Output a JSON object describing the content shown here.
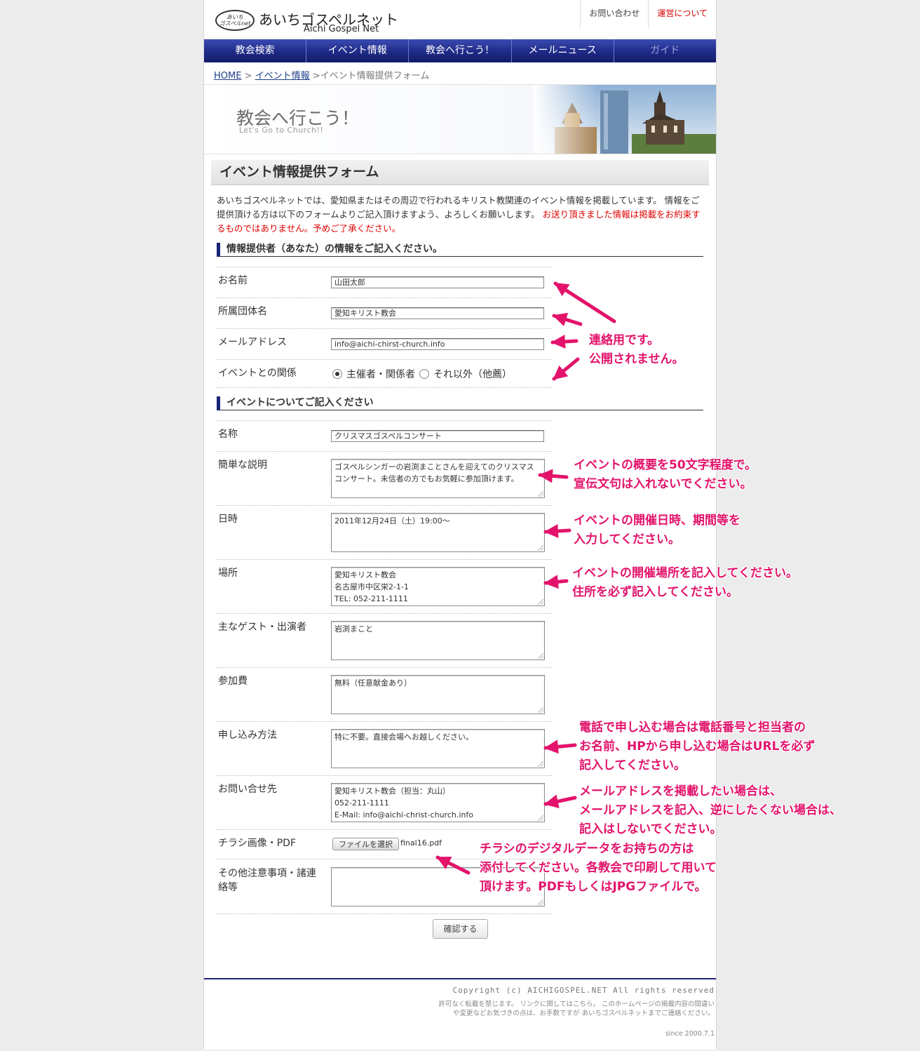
{
  "header": {
    "logo_mark": "あいち\nゴスペルnet",
    "logo_jp": "あいちゴスペルネット",
    "logo_en": "Aichi Gospel Net",
    "top_links": [
      "お問い合わせ",
      "運営について"
    ]
  },
  "nav": [
    "教会検索",
    "イベント情報",
    "教会へ行こう！",
    "メールニュース",
    "ガイド"
  ],
  "breadcrumb": {
    "home": "HOME",
    "sep1": " > ",
    "events": "イベント情報",
    "current": " >イベント情報提供フォーム"
  },
  "banner": {
    "title": "教会へ行こう！",
    "subtitle": "Let's Go to Church!!"
  },
  "page_title": "イベント情報提供フォーム",
  "intro": {
    "text": "あいちゴスペルネットでは、愛知県またはその周辺で行われるキリスト教関連のイベント情報を掲載しています。 情報をご提供頂ける方は以下のフォームよりご記入頂けますよう、よろしくお願いします。 ",
    "red": "お送り頂きました情報は掲載をお約束するものではありません。予めご了承ください。"
  },
  "section1": "情報提供者（あなた）の情報をご記入ください。",
  "section2": "イベントについてご記入ください",
  "fields": {
    "name": {
      "label": "お名前",
      "value": "山田太郎"
    },
    "org": {
      "label": "所属団体名",
      "value": "愛知キリスト教会"
    },
    "email": {
      "label": "メールアドレス",
      "value": "info@aichi-chirst-church.info"
    },
    "relation": {
      "label": "イベントとの関係",
      "option1": "主催者・関係者",
      "option2": "それ以外（他薦）"
    },
    "title": {
      "label": "名称",
      "value": "クリスマスゴスペルコンサート"
    },
    "desc": {
      "label": "簡単な説明",
      "value": "ゴスペルシンガーの岩渕まことさんを迎えてのクリスマスコンサート。未信者の方でもお気軽に参加頂けます。"
    },
    "datetime": {
      "label": "日時",
      "value": "2011年12月24日（土）19:00〜"
    },
    "place": {
      "label": "場所",
      "value": "愛知キリスト教会\n名古屋市中区栄2-1-1\nTEL: 052-211-1111"
    },
    "guest": {
      "label": "主なゲスト・出演者",
      "value": "岩渕まこと"
    },
    "fee": {
      "label": "参加費",
      "value": "無料（任意献金あり）"
    },
    "apply": {
      "label": "申し込み方法",
      "value": "特に不要。直接会場へお越しください。"
    },
    "contact": {
      "label": "お問い合せ先",
      "value": "愛知キリスト教会（担当：丸山）\n052-211-1111\nE-Mail: info@aichi-christ-church.info"
    },
    "flyer": {
      "label": "チラシ画像・PDF",
      "button": "ファイルを選択",
      "file": "final16.pdf"
    },
    "other": {
      "label": "その他注意事項・諸連絡等",
      "value": ""
    }
  },
  "confirm_button": "確認する",
  "footer": {
    "copyright": "Copyright (c) AICHIGOSPEL.NET   All rights reserved",
    "notes": "許可なく転載を禁じます。 リンクに関してはこちら。 このホームページの掲載内容の間違いや変更などお気づきの点は、お手数ですが あいちゴスペルネットまでご連絡ください。",
    "since": "since 2000.7.1"
  },
  "annotations": {
    "contact_use": [
      "連絡用です。",
      "公開されません。"
    ],
    "desc_note": [
      "イベントの概要を50文字程度で。",
      "宣伝文句は入れないでください。"
    ],
    "datetime_note": [
      "イベントの開催日時、期間等を",
      "入力してください。"
    ],
    "place_note": [
      "イベントの開催場所を記入してください。",
      "住所を必ず記入してください。"
    ],
    "apply_note": [
      "電話で申し込む場合は電話番号と担当者の",
      "お名前、HPから申し込む場合はURLを必ず",
      "記入してください。"
    ],
    "contact_note": [
      "メールアドレスを掲載したい場合は、",
      "メールアドレスを記入、逆にしたくない場合は、",
      "記入はしないでください。"
    ],
    "flyer_note": [
      "チラシのデジタルデータをお持ちの方は",
      "添付してください。各教会で印刷して用いて",
      "頂けます。PDFもしくはJPGファイルで。"
    ]
  },
  "colors": {
    "nav": "#1f2a86",
    "accent_red": "#e00000",
    "annotation": "#e3136b"
  }
}
